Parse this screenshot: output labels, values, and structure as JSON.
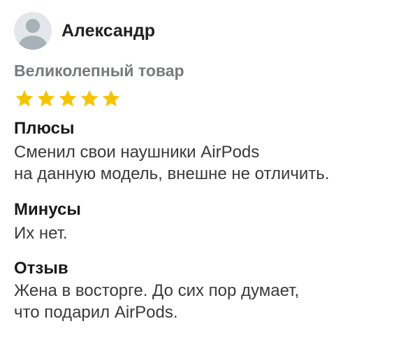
{
  "review": {
    "author": "Александр",
    "title": "Великолепный товар",
    "rating": 5,
    "rating_max": 5,
    "star_color": "#f5c400",
    "pros": {
      "label": "Плюсы",
      "lines": [
        "Сменил свои наушники AirPods",
        "на данную модель, внешне не отличить."
      ]
    },
    "cons": {
      "label": "Минусы",
      "lines": [
        "Их нет."
      ]
    },
    "comment": {
      "label": "Отзыв",
      "lines": [
        "Жена в восторге. До сих пор думает,",
        "что подарил AirPods."
      ]
    }
  }
}
